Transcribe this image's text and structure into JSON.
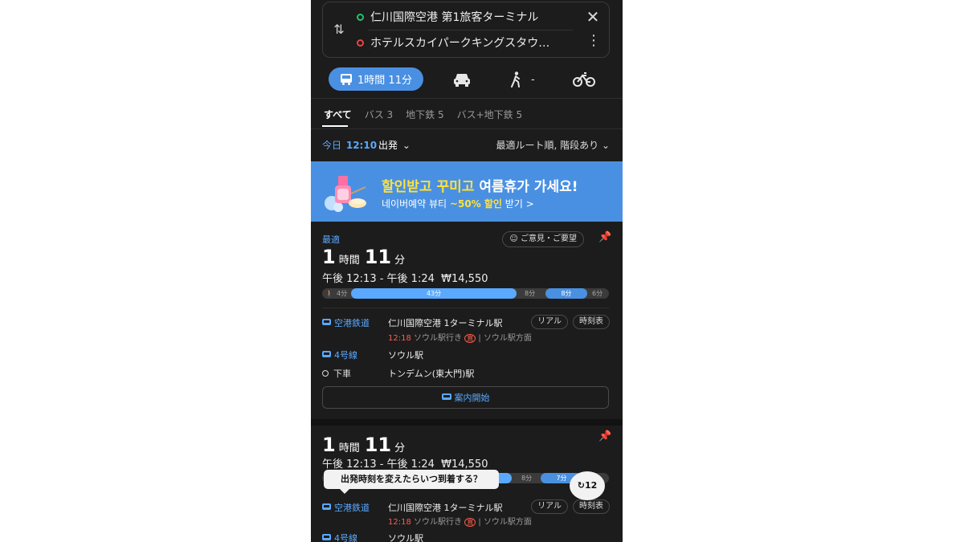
{
  "route": {
    "origin": "仁川国際空港 第1旅客ターミナル",
    "destination": "ホテルスカイパークキングスタウ…"
  },
  "modes": {
    "transit_label": "1時間 11分",
    "walk_label": "-"
  },
  "filter_tabs": [
    "すべて",
    "バス 3",
    "地下鉄 5",
    "バス+地下鉄 5"
  ],
  "departure": {
    "today": "今日",
    "time": "12:10",
    "suffix": "出発",
    "sort": "最適ルート順, 階段あり"
  },
  "ad": {
    "title_part1": "할인받고 꾸미고",
    "title_part2": " 여름휴가 가세요!",
    "sub_part1": "네이버예약 뷰티 ",
    "sub_part2": "~50% 할인",
    "sub_part3": " 받기 >"
  },
  "routes": [
    {
      "badge": "最適",
      "feedback": "ご意見・ご要望",
      "dur_h": "1",
      "dur_h_unit": "時間",
      "dur_m": "11",
      "dur_m_unit": "分",
      "timeline": "午後 12:13 - 午後 1:24",
      "fare": "₩14,550",
      "bar": {
        "walk1": "4分",
        "rail": "43分",
        "wait1": "8分",
        "bus": "8分",
        "walk2": "6分"
      },
      "steps": [
        {
          "line": "空港鉄道",
          "station": "仁川国際空港 1ターミナル駅"
        },
        {
          "line": "4号線",
          "station": "ソウル駅"
        },
        {
          "line": "下車",
          "station": "トンデムン(東大門)駅"
        }
      ],
      "info_time": "12:18",
      "info_dest": "ソウル駅行き",
      "info_badge": "直",
      "info_dir": "ソウル駅方面",
      "chip_real": "リアル",
      "chip_timetable": "時刻表",
      "guide": "案内開始"
    },
    {
      "dur_h": "1",
      "dur_h_unit": "時間",
      "dur_m": "11",
      "dur_m_unit": "分",
      "timeline": "午後 12:13 - 午後 1:24",
      "fare": "₩14,550",
      "bar": {
        "wait1": "8分",
        "bus": "7分"
      },
      "steps": [
        {
          "line": "空港鉄道",
          "station": "仁川国際空港 1ターミナル駅"
        },
        {
          "line": "4号線",
          "station": "ソウル駅"
        }
      ],
      "info_time": "12:18",
      "info_dest": "ソウル駅行き",
      "info_badge": "直",
      "info_dir": "ソウル駅方面",
      "chip_real": "リアル",
      "chip_timetable": "時刻表"
    }
  ],
  "tooltip": "出発時刻を変えたらいつ到着する？",
  "refresh_badge": "12"
}
